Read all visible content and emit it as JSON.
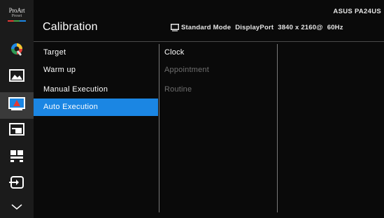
{
  "logo": {
    "line1": "ProArt",
    "line2": "Preset"
  },
  "header": {
    "title": "Calibration",
    "model": "ASUS PA24US",
    "mode": "Standard Mode",
    "input": "DisplayPort",
    "resolution": "3840 x 2160@",
    "refresh": "60Hz"
  },
  "sidebar": {
    "icons": [
      {
        "name": "proart-palette-icon",
        "selected": false
      },
      {
        "name": "image-icon",
        "selected": false
      },
      {
        "name": "calibration-icon",
        "selected": true
      },
      {
        "name": "pip-pbp-icon",
        "selected": false
      },
      {
        "name": "qualiti-fit-icon",
        "selected": false
      },
      {
        "name": "input-select-icon",
        "selected": false
      },
      {
        "name": "chevron-down-icon",
        "selected": false
      }
    ]
  },
  "menu": {
    "items": [
      {
        "label": "Target"
      },
      {
        "label": "Warm up"
      },
      {
        "label": "Manual Execution"
      },
      {
        "label": "Auto Execution"
      }
    ],
    "active_index": 3
  },
  "submenu": {
    "items": [
      {
        "label": "Clock",
        "enabled": true
      },
      {
        "label": "Appointment",
        "enabled": false
      },
      {
        "label": "Routine",
        "enabled": false
      }
    ]
  },
  "colors": {
    "accent": "#1b86e3",
    "sidebar_bg": "#1b1b1b",
    "disabled_text": "#6f6f6f"
  }
}
